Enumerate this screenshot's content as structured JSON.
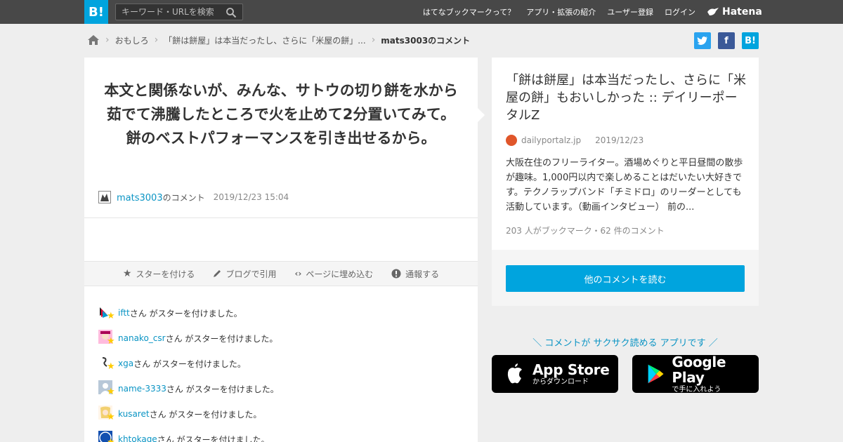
{
  "header": {
    "logo": "B!",
    "search_placeholder": "キーワード・URLを検索",
    "nav": [
      "はてなブックマークって？",
      "アプリ・拡張の紹介",
      "ユーザー登録",
      "ログイン"
    ],
    "brand": "Hatena"
  },
  "breadcrumb": {
    "items": [
      "おもしろ",
      "「餅は餅屋」は本当だったし、さらに「米屋の餅」..."
    ],
    "current": "mats3003のコメント"
  },
  "share": {
    "twitter": "t",
    "facebook": "f",
    "hatena": "B!"
  },
  "comment": {
    "text": "本文と関係ないが、みんな、サトウの切り餅を水から茹でて沸騰したところで火を止めて2分置いてみて。餅のベストパフォーマンスを引き出せるから。",
    "user": "mats3003",
    "user_suffix": "のコメント",
    "date": "2019/12/23 15:04"
  },
  "actions": [
    "スターを付ける",
    "ブログで引用",
    "ページに埋め込む",
    "通報する"
  ],
  "stars": [
    {
      "user": "iftt",
      "suffix": "さん がスターを付けました。"
    },
    {
      "user": "nanako_csr",
      "suffix": "さん がスターを付けました。"
    },
    {
      "user": "xga",
      "suffix": "さん がスターを付けました。"
    },
    {
      "user": "name-3333",
      "suffix": "さん がスターを付けました。"
    },
    {
      "user": "kusaret",
      "suffix": "さん がスターを付けました。"
    },
    {
      "user": "khtokage",
      "suffix": "さん がスターを付けました。"
    }
  ],
  "article": {
    "title": "「餅は餅屋」は本当だったし、さらに「米屋の餅」もおいしかった :: デイリーポータルZ",
    "domain": "dailyportalz.jp",
    "date": "2019/12/23",
    "description": "大阪在住のフリーライター。酒場めぐりと平日昼間の散歩が趣味。1,000円以内で楽しめることはだいたい大好きです。テクノラップバンド「チミドロ」のリーダーとしても活動しています。（動画インタビュー） 前の...",
    "counts": "203 人がブックマーク・62 件のコメント",
    "more_button": "他のコメントを読む"
  },
  "promo": {
    "text": "＼ コメントが サクサク読める アプリです ／",
    "apple_small": "からダウンロード",
    "apple_big": "App Store",
    "google_big": "Google Play",
    "google_small": "で手に入れよう"
  },
  "colors": {
    "accent": "#00a4de",
    "header_bg": "#484848",
    "star": "#ffcc00"
  }
}
